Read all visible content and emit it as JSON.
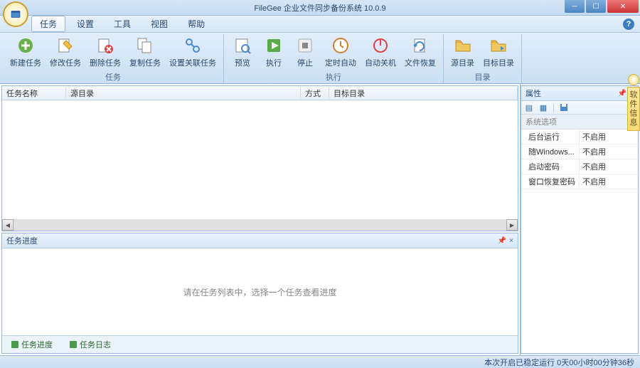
{
  "title": "FileGee 企业文件同步备份系统 10.0.9",
  "menu": {
    "task": "任务",
    "settings": "设置",
    "tools": "工具",
    "view": "视图",
    "help": "帮助"
  },
  "ribbon": {
    "groups": {
      "task": {
        "label": "任务",
        "new": "新建任务",
        "edit": "修改任务",
        "delete": "删除任务",
        "copy": "复制任务",
        "related": "设置关联任务"
      },
      "exec": {
        "label": "执行",
        "preview": "预览",
        "run": "执行",
        "stop": "停止",
        "sched": "定时自动",
        "shutdown": "自动关机",
        "restore": "文件恢复"
      },
      "dir": {
        "label": "目录",
        "src": "源目录",
        "dst": "目标目录"
      }
    }
  },
  "taskList": {
    "cols": {
      "name": "任务名称",
      "src": "源目录",
      "mode": "方式",
      "dst": "目标目录"
    }
  },
  "progress": {
    "title": "任务进度",
    "empty": "请在任务列表中，选择一个任务查看进度"
  },
  "bottomTabs": {
    "progress": "任务进度",
    "log": "任务日志"
  },
  "props": {
    "title": "属性",
    "group": "系统选项",
    "rows": [
      {
        "k": "后台运行",
        "v": "不启用"
      },
      {
        "k": "随Windows...",
        "v": "不启用"
      },
      {
        "k": "启动密码",
        "v": "不启用"
      },
      {
        "k": "窗口恢复密码",
        "v": "不启用"
      }
    ]
  },
  "sideTab": "软件信息",
  "status": "本次开启已稳定运行 0天00小时00分钟36秒"
}
